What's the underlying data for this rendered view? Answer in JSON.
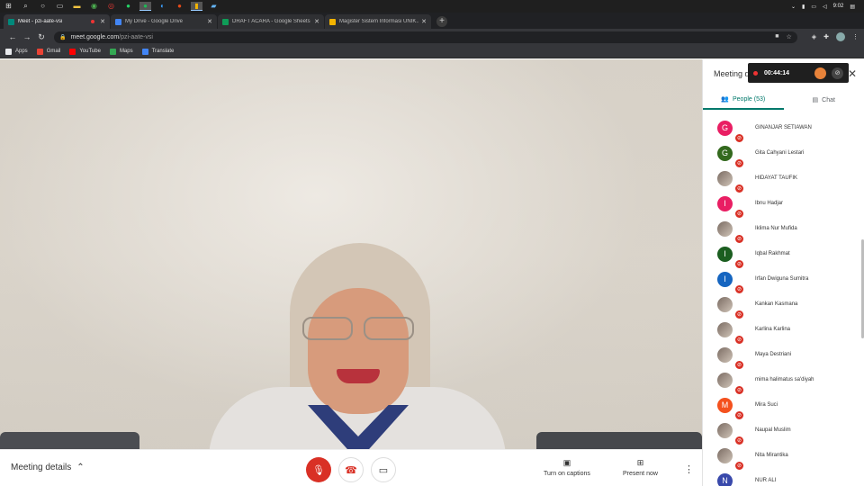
{
  "taskbar": {
    "time": "9:02",
    "pinned_icons": [
      "windows-icon",
      "search-icon",
      "cortana-icon",
      "task-view-icon",
      "file-explorer-icon",
      "chrome-icon",
      "opera-icon",
      "whatsapp-icon",
      "spotify-icon",
      "edge-icon",
      "powerpoint-icon",
      "app-icon",
      "photos-icon"
    ]
  },
  "browser": {
    "tabs": [
      {
        "title": "Meet - pzi-aate-vsi",
        "active": true,
        "recording": true,
        "color": "#00897b"
      },
      {
        "title": "My Drive - Google Drive",
        "active": false,
        "recording": false,
        "color": "#4285f4"
      },
      {
        "title": "DRAFT ACARA - Google Sheets",
        "active": false,
        "recording": false,
        "color": "#0f9d58"
      },
      {
        "title": "Magister Sistem Informasi UNIK...",
        "active": false,
        "recording": false,
        "color": "#f4b400"
      }
    ],
    "url_host": "meet.google.com",
    "url_path": "/pzi-aate-vsi",
    "bookmarks": [
      {
        "label": "Apps",
        "color": "#e8eaed"
      },
      {
        "label": "Gmail",
        "color": "#ea4335"
      },
      {
        "label": "YouTube",
        "color": "#ff0000"
      },
      {
        "label": "Maps",
        "color": "#34a853"
      },
      {
        "label": "Translate",
        "color": "#4285f4"
      }
    ]
  },
  "meet": {
    "meeting_details_label": "Meeting details",
    "captions_label": "Turn on captions",
    "present_label": "Present now",
    "panel_title": "Meeting details",
    "recording_time": "00:44:14",
    "people_tab": "People (53)",
    "chat_tab": "Chat",
    "accent_color": "#00796b",
    "mute_color": "#d93025",
    "participants": [
      {
        "initial": "G",
        "name": "GINANJAR SETIAWAN",
        "color": "#e91e63",
        "photo": false
      },
      {
        "initial": "G",
        "name": "Gita Cahyani Lestari",
        "color": "#33691e",
        "photo": false
      },
      {
        "initial": "",
        "name": "HIDAYAT TAUFIK",
        "color": "#8d6e63",
        "photo": true
      },
      {
        "initial": "I",
        "name": "Ibnu Hadjar",
        "color": "#e91e63",
        "photo": false
      },
      {
        "initial": "",
        "name": "Iklima Nur Mufida",
        "color": "#607d8b",
        "photo": true
      },
      {
        "initial": "I",
        "name": "Iqbal Rakhmat",
        "color": "#1b5e20",
        "photo": false
      },
      {
        "initial": "I",
        "name": "Irfan Dwiguna Sumitra",
        "color": "#1565c0",
        "photo": false
      },
      {
        "initial": "",
        "name": "Kankan Kasmana",
        "color": "#9e9e9e",
        "photo": true
      },
      {
        "initial": "",
        "name": "Karlina Karlina",
        "color": "#a1887f",
        "photo": true
      },
      {
        "initial": "",
        "name": "Maya Destriani",
        "color": "#455a64",
        "photo": true
      },
      {
        "initial": "",
        "name": "mima halimatus sa'diyah",
        "color": "#795548",
        "photo": true
      },
      {
        "initial": "M",
        "name": "Mira Suci",
        "color": "#f4511e",
        "photo": false
      },
      {
        "initial": "",
        "name": "Naupal Muslim",
        "color": "#8d6e63",
        "photo": true
      },
      {
        "initial": "",
        "name": "Nita Mirantika",
        "color": "#424242",
        "photo": true
      },
      {
        "initial": "N",
        "name": "NUR ALI",
        "color": "#3949ab",
        "photo": false
      }
    ]
  }
}
